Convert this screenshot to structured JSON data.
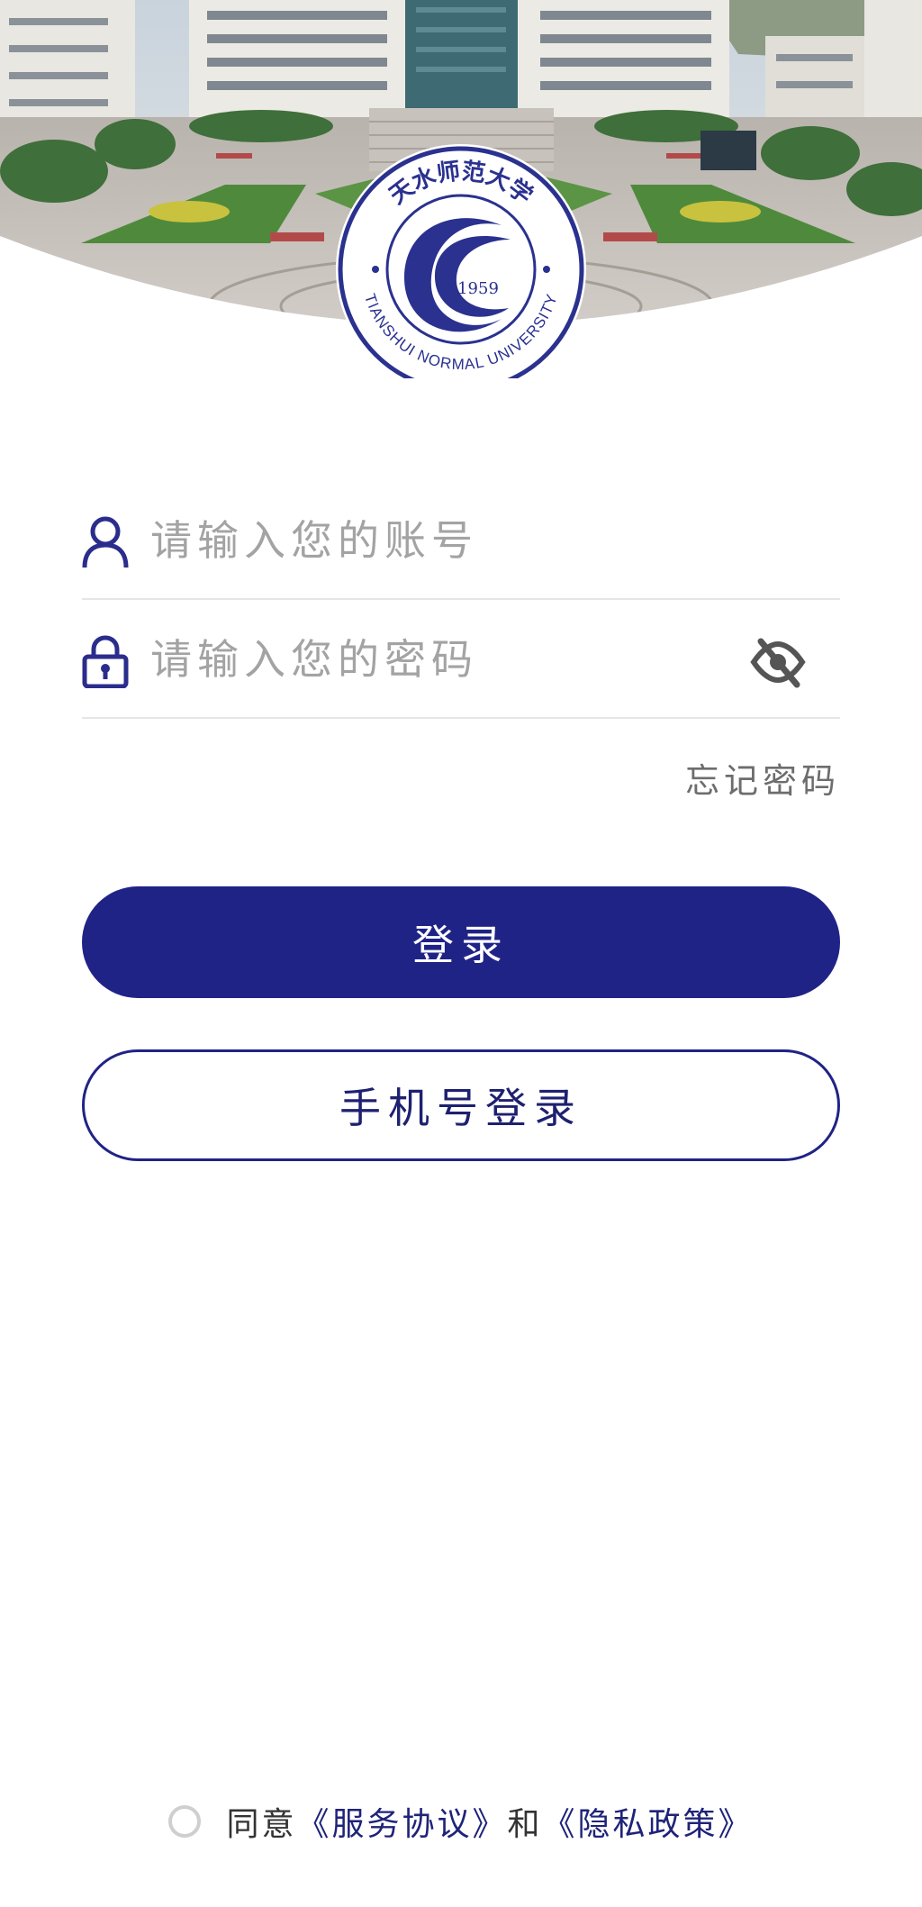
{
  "logo": {
    "name_cn": "天水师范大学",
    "name_en": "TIANSHUI NORMAL UNIVERSITY",
    "year": "1959"
  },
  "form": {
    "account_placeholder": "请输入您的账号",
    "password_placeholder": "请输入您的密码",
    "forgot_label": "忘记密码",
    "login_label": "登录",
    "phone_login_label": "手机号登录"
  },
  "agreement": {
    "prefix": "同意",
    "service_link": "《服务协议》",
    "and": "和",
    "privacy_link": "《隐私政策》"
  },
  "colors": {
    "accent": "#202386",
    "divider": "#e6e6e6",
    "placeholder": "#a3a3a3"
  },
  "icons": {
    "account": "user-icon",
    "password": "lock-icon",
    "toggle": "eye-off-icon"
  }
}
